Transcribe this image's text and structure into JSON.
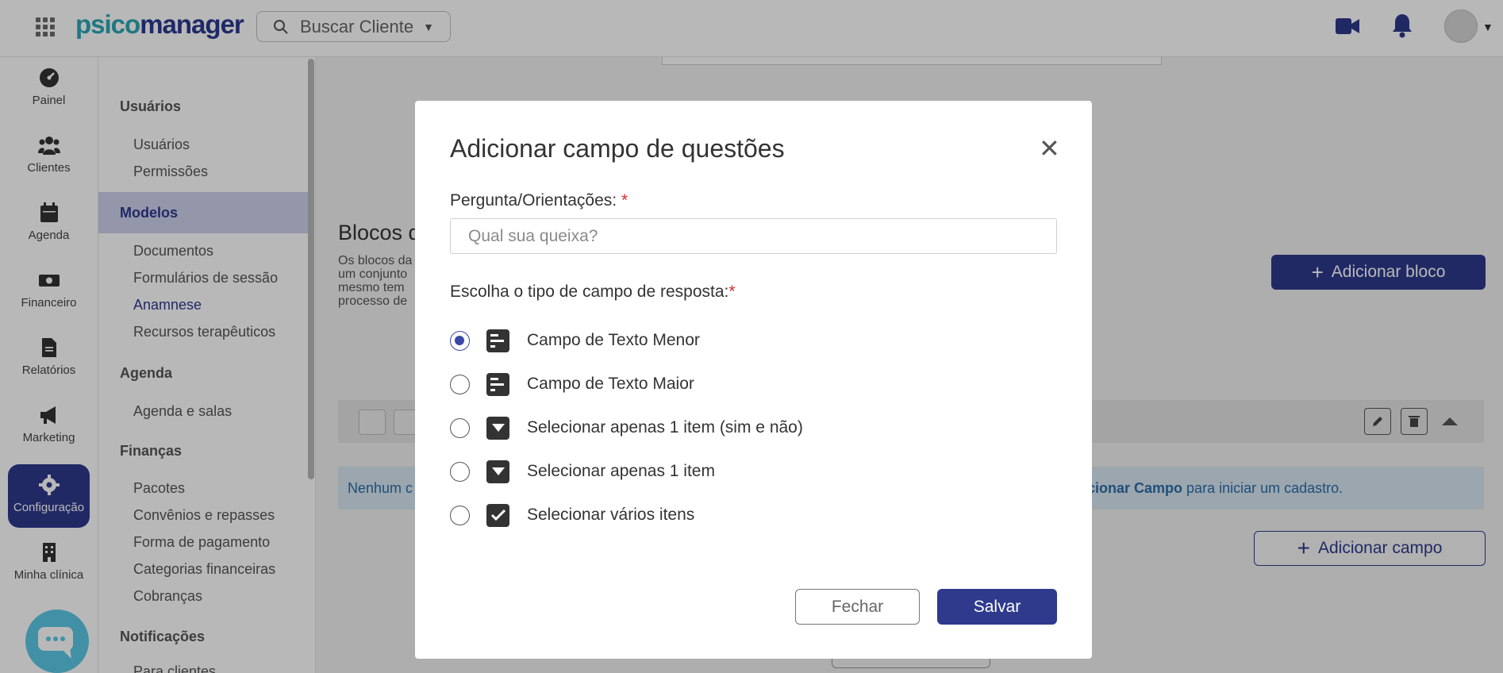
{
  "header": {
    "logo_part1": "psico",
    "logo_part2": "manager",
    "search_label": "Buscar Cliente"
  },
  "sidebar": {
    "items": [
      {
        "label": "Painel"
      },
      {
        "label": "Clientes"
      },
      {
        "label": "Agenda"
      },
      {
        "label": "Financeiro"
      },
      {
        "label": "Relatórios"
      },
      {
        "label": "Marketing"
      },
      {
        "label": "Configuração"
      },
      {
        "label": "Minha clínica"
      }
    ]
  },
  "submenu": {
    "usuarios": "Usuários",
    "usuarios_items": [
      "Usuários",
      "Permissões"
    ],
    "modelos": "Modelos",
    "modelos_items": [
      "Documentos",
      "Formulários de sessão",
      "Anamnese",
      "Recursos terapêuticos"
    ],
    "agenda": "Agenda",
    "agenda_items": [
      "Agenda e salas"
    ],
    "financas": "Finanças",
    "financas_items": [
      "Pacotes",
      "Convênios e repasses",
      "Forma de pagamento",
      "Categorias financeiras",
      "Cobranças"
    ],
    "notificacoes": "Notificações",
    "notificacoes_items": [
      "Para clientes"
    ]
  },
  "main": {
    "blocks_title": "Blocos d",
    "blocks_desc": [
      "Os blocos da",
      "um conjunto",
      "mesmo tem",
      "processo de"
    ],
    "add_block": "Adicionar bloco",
    "empty_prefix": "Nenhum c",
    "empty_link": "cionar Campo",
    "empty_suffix": "para iniciar um cadastro.",
    "add_field": "Adicionar campo"
  },
  "modal": {
    "title": "Adicionar campo de questões",
    "question_label": "Pergunta/Orientações:",
    "required_mark": "*",
    "question_placeholder": "Qual sua queixa?",
    "type_label": "Escolha o tipo de campo de resposta:",
    "options": [
      {
        "label": "Campo de Texto Menor",
        "icon": "short-text-icon",
        "selected": true
      },
      {
        "label": "Campo de Texto Maior",
        "icon": "long-text-icon",
        "selected": false
      },
      {
        "label": "Selecionar apenas 1 item (sim e não)",
        "icon": "dropdown-icon",
        "selected": false
      },
      {
        "label": "Selecionar apenas 1 item",
        "icon": "dropdown-icon",
        "selected": false
      },
      {
        "label": "Selecionar vários itens",
        "icon": "checkbox-icon",
        "selected": false
      }
    ],
    "close_button": "Fechar",
    "save_button": "Salvar"
  },
  "colors": {
    "primary": "#2f3a8d",
    "accent": "#2aa7b4",
    "required": "#d62b2b"
  }
}
